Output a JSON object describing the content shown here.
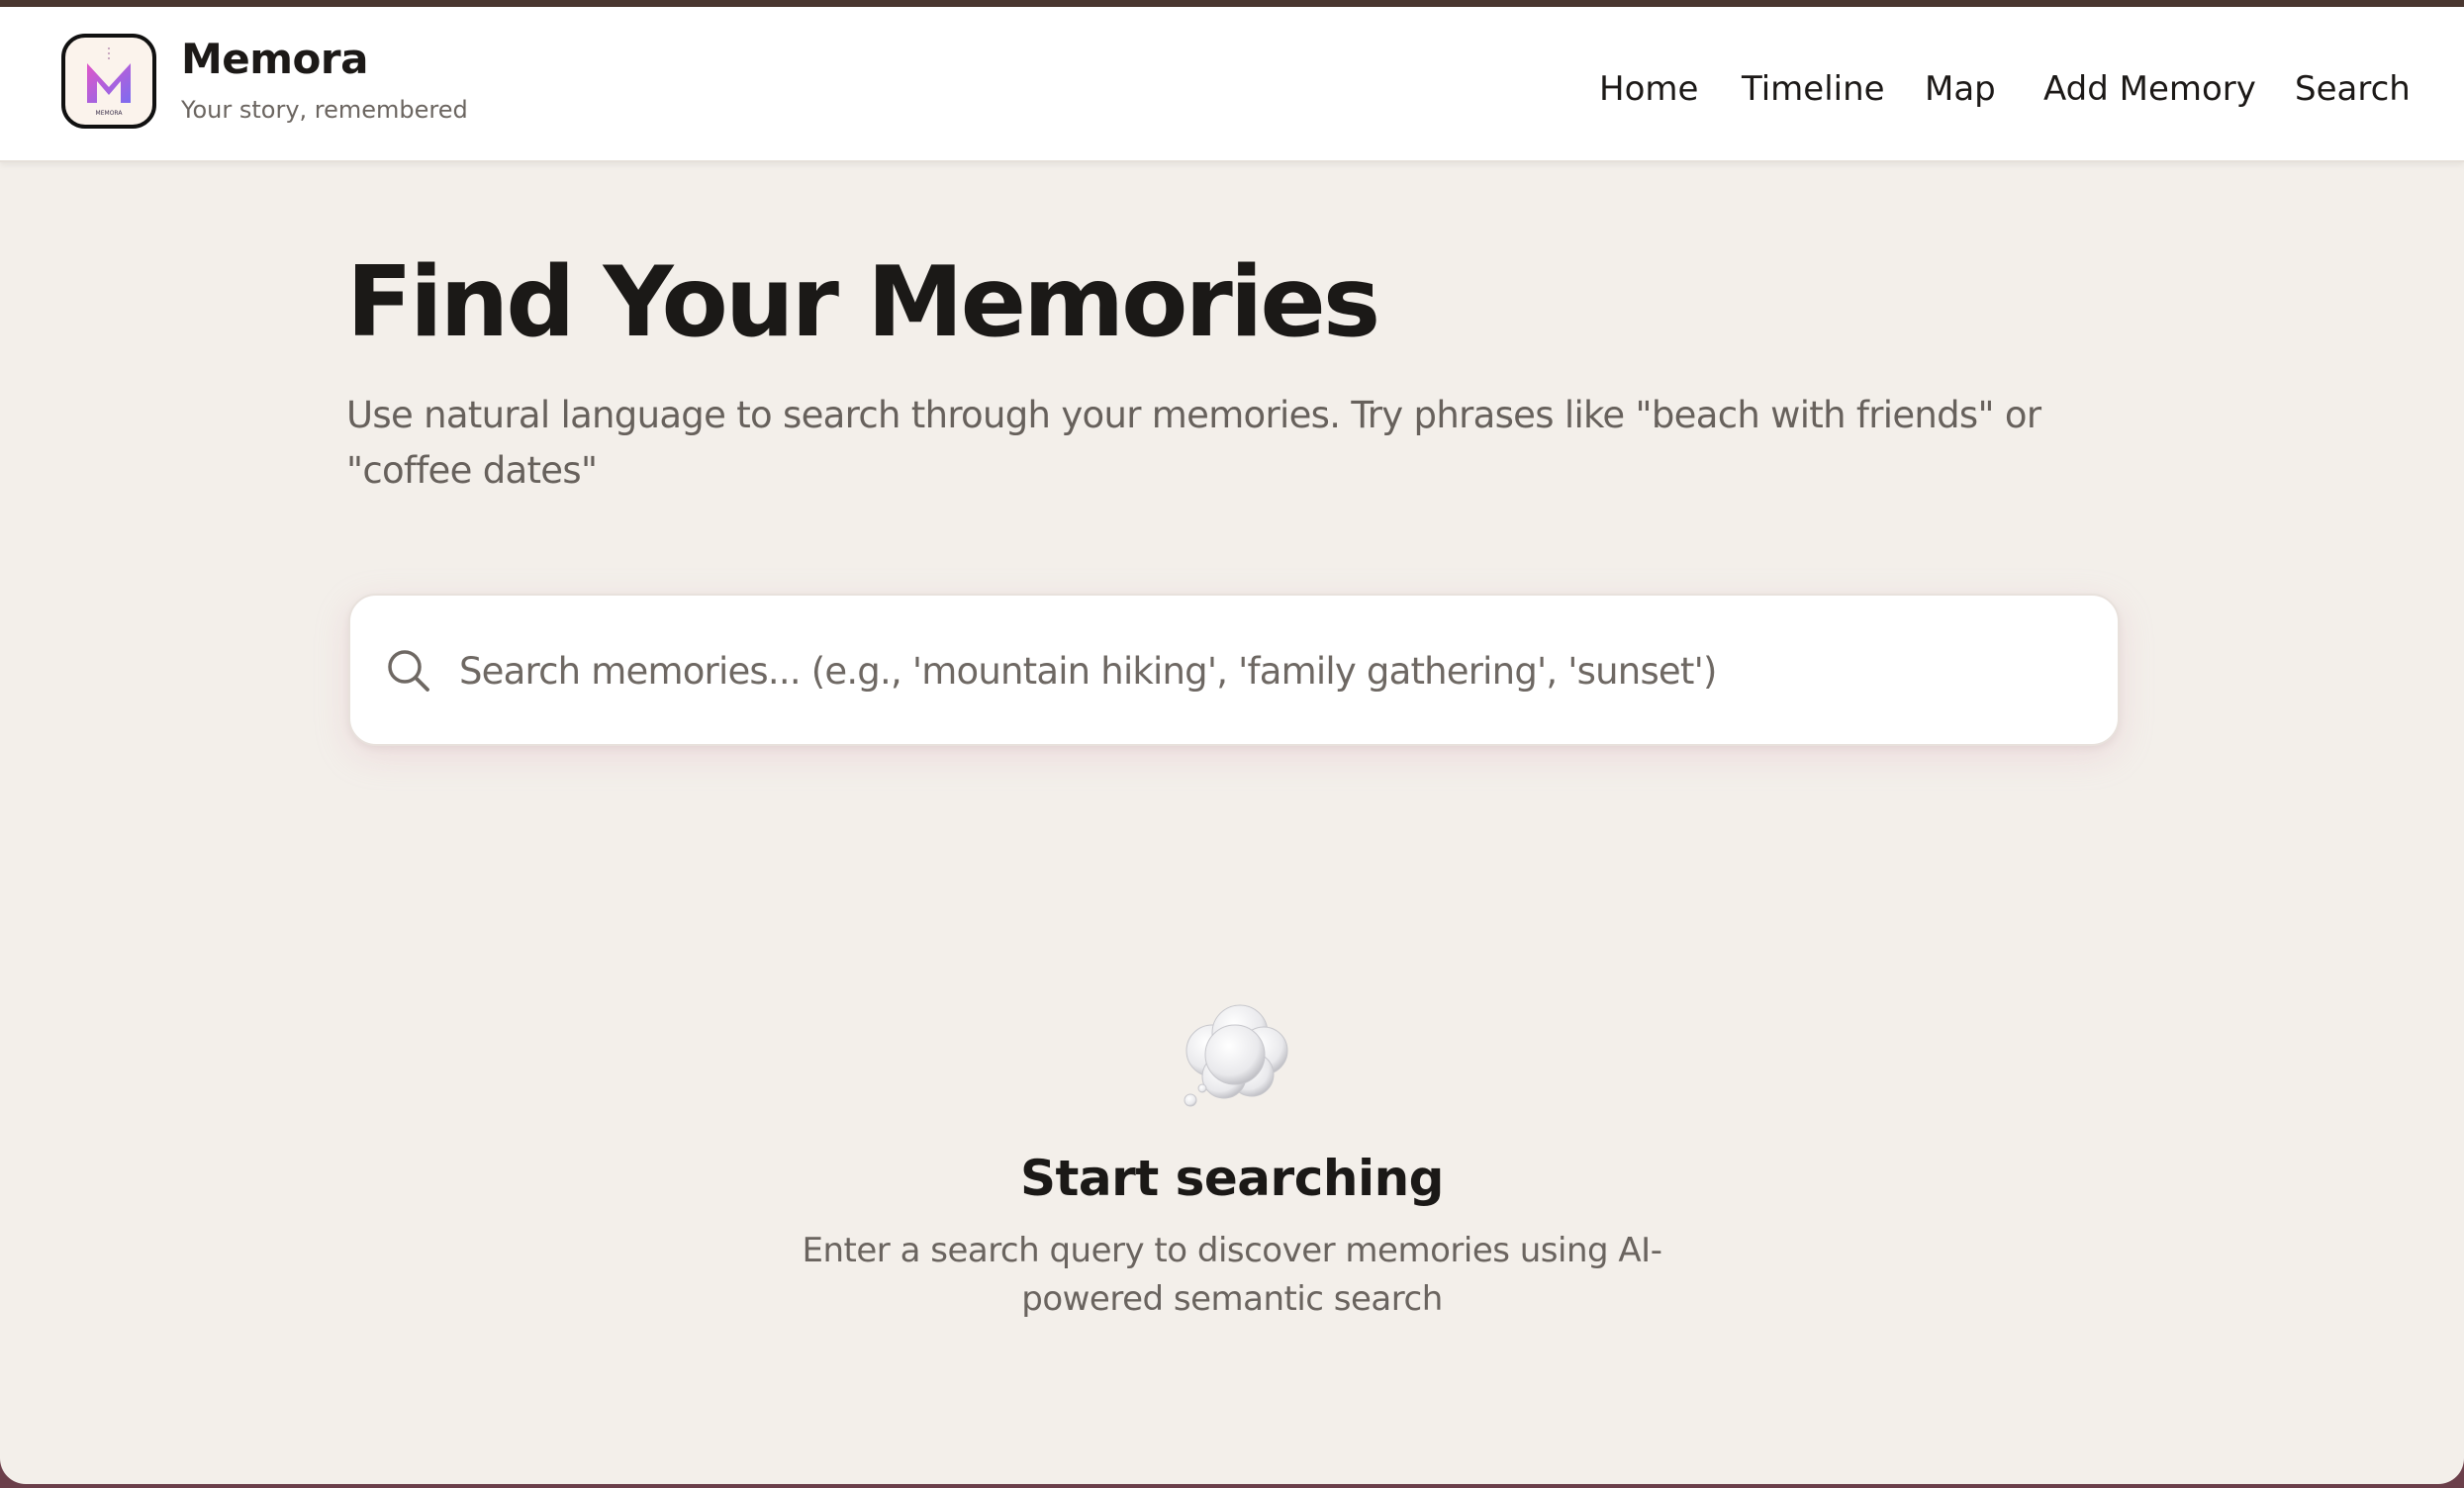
{
  "app": {
    "name": "Memora",
    "tagline": "Your story, remembered",
    "logo_text": "MEMORA"
  },
  "nav": {
    "items": [
      {
        "label": "Home"
      },
      {
        "label": "Timeline"
      },
      {
        "label": "Map"
      },
      {
        "label": "Add Memory"
      },
      {
        "label": "Search"
      }
    ]
  },
  "main": {
    "title": "Find Your Memories",
    "subtitle": "Use natural language to search through your memories. Try phrases like \"beach with friends\" or \"coffee dates\""
  },
  "search": {
    "placeholder": "Search memories... (e.g., 'mountain hiking', 'family gathering', 'sunset')",
    "value": ""
  },
  "empty_state": {
    "icon": "thought-bubble-icon",
    "title": "Start searching",
    "description": "Enter a search query to discover memories using AI-powered semantic search"
  },
  "colors": {
    "page_background": "#f3efea",
    "header_background": "#ffffff",
    "text_primary": "#1c1917",
    "text_secondary": "#67615c",
    "logo_gradient_start": "#e056c8",
    "logo_gradient_end": "#7c6cf0",
    "outer_frame": "#6b3f4a"
  }
}
